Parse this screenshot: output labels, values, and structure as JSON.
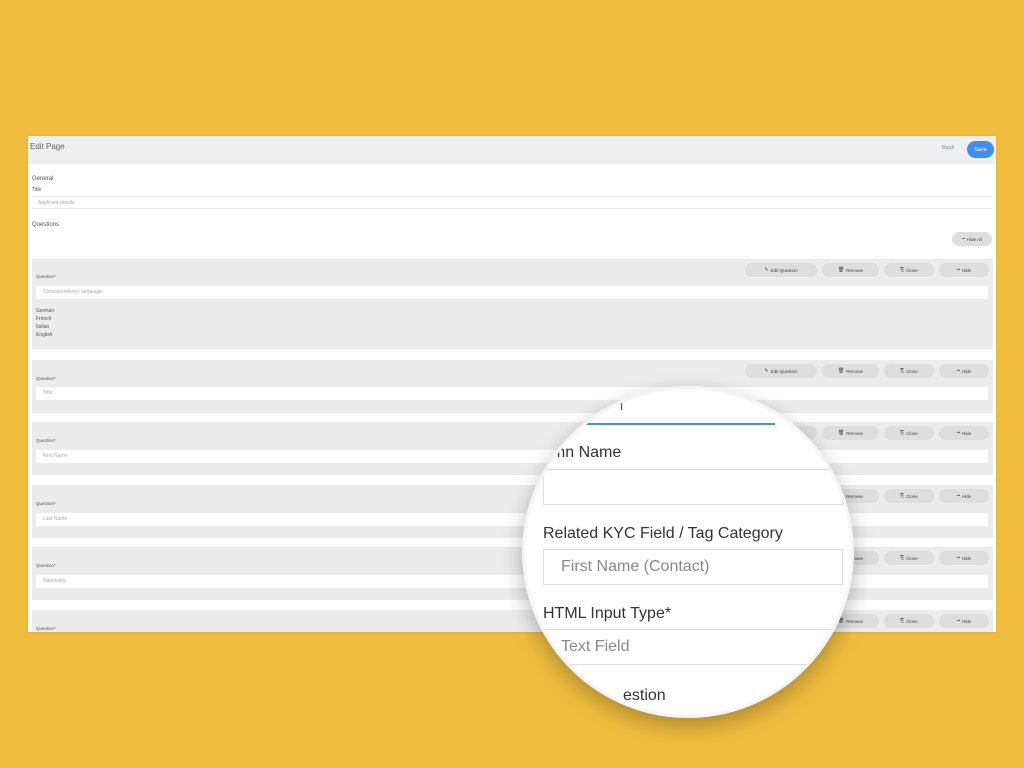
{
  "page": {
    "title": "Edit Page",
    "back_label": "Back",
    "save_label": "Save"
  },
  "general": {
    "heading": "General",
    "title_label": "Title",
    "title_value": "Applicant details"
  },
  "questions": {
    "heading": "Questions",
    "hide_all_label": "Hide All",
    "button_labels": {
      "edit": "Edit Question",
      "remove": "Remove",
      "clone": "Clone",
      "hide": "Hide"
    },
    "items": [
      {
        "label": "Question*",
        "value": "Correspondence language",
        "options": [
          "German",
          "French",
          "Italian",
          "English"
        ]
      },
      {
        "label": "Question*",
        "value": "Title"
      },
      {
        "label": "Question*",
        "value": "First Name"
      },
      {
        "label": "Question*",
        "value": "Last Name"
      },
      {
        "label": "Question*",
        "value": "Nationality"
      },
      {
        "label": "Question*",
        "value": ""
      }
    ]
  },
  "zoom": {
    "fragment_top": "l",
    "column_name_label": "umn Name",
    "column_name_value": "",
    "kyc_label": "Related KYC Field / Tag Category",
    "kyc_value": "First Name (Contact)",
    "input_type_label": "HTML Input Type*",
    "input_type_value": "Text Field",
    "bottom_fragment": "estion"
  },
  "icons": {
    "edit": "edit-icon",
    "remove": "trash-icon",
    "clone": "clone-icon",
    "hide": "minus-icon"
  },
  "colors": {
    "background": "#F0BD3F",
    "accent": "#3F8EF0",
    "block": "#ECECEC"
  }
}
